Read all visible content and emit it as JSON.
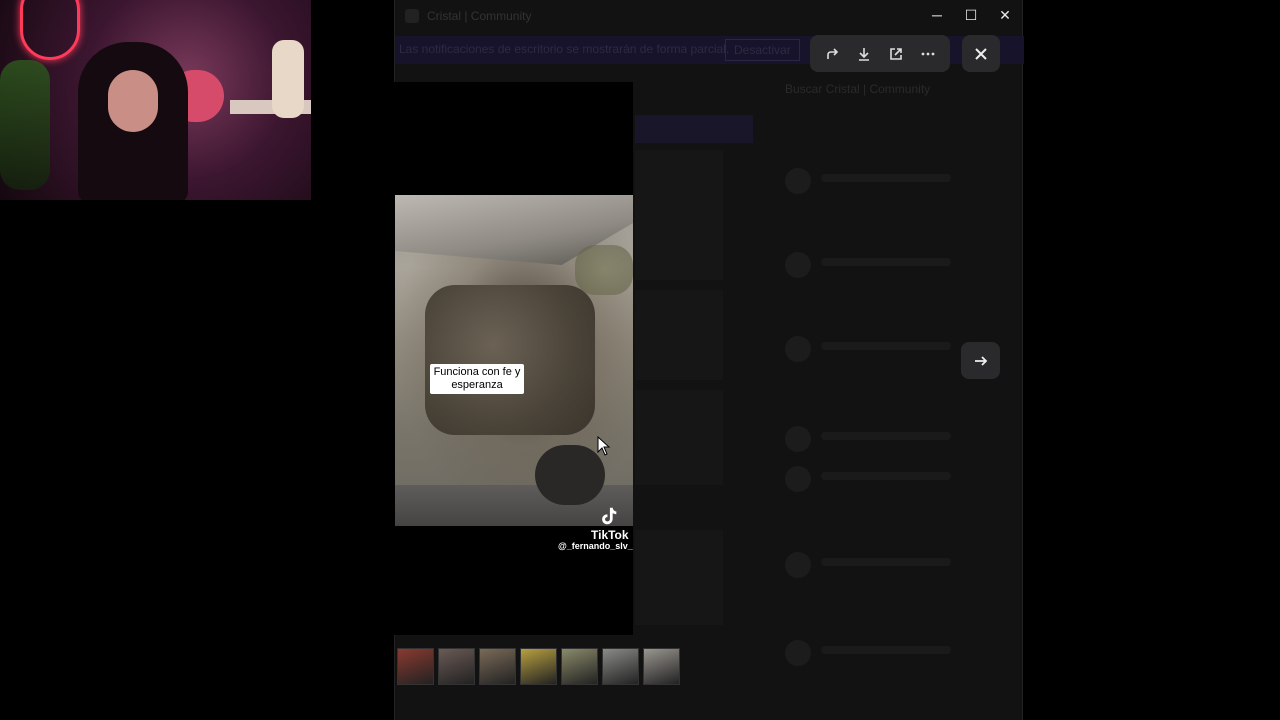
{
  "window": {
    "title": "Cristal | Community",
    "controls": {
      "minimize": "─",
      "maximize": "☐",
      "close": "✕"
    }
  },
  "notice": {
    "text": "Las notificaciones de escritorio se mostrarán de forma parcial.",
    "action": "Desactivar"
  },
  "right_panel": {
    "title": "Buscar Cristal | Community"
  },
  "viewer": {
    "toolbar": [
      {
        "name": "forward-icon",
        "glyph": "↪"
      },
      {
        "name": "download-icon",
        "glyph": "⤓"
      },
      {
        "name": "open-external-icon",
        "glyph": "⧉"
      },
      {
        "name": "more-icon",
        "glyph": "⋯"
      }
    ],
    "close_glyph": "✕",
    "next_glyph": "→"
  },
  "video": {
    "caption": "Funciona con fe y esperanza",
    "brand": "TikTok",
    "handle": "@_fernando_slv_"
  },
  "thumbnails": [
    {
      "color": "#8a3a30"
    },
    {
      "color": "#6a5a55"
    },
    {
      "color": "#7a6a58"
    },
    {
      "color": "#b8a040"
    },
    {
      "color": "#8a8a6a"
    },
    {
      "color": "#8a8a86"
    },
    {
      "color": "#9a9690"
    }
  ]
}
